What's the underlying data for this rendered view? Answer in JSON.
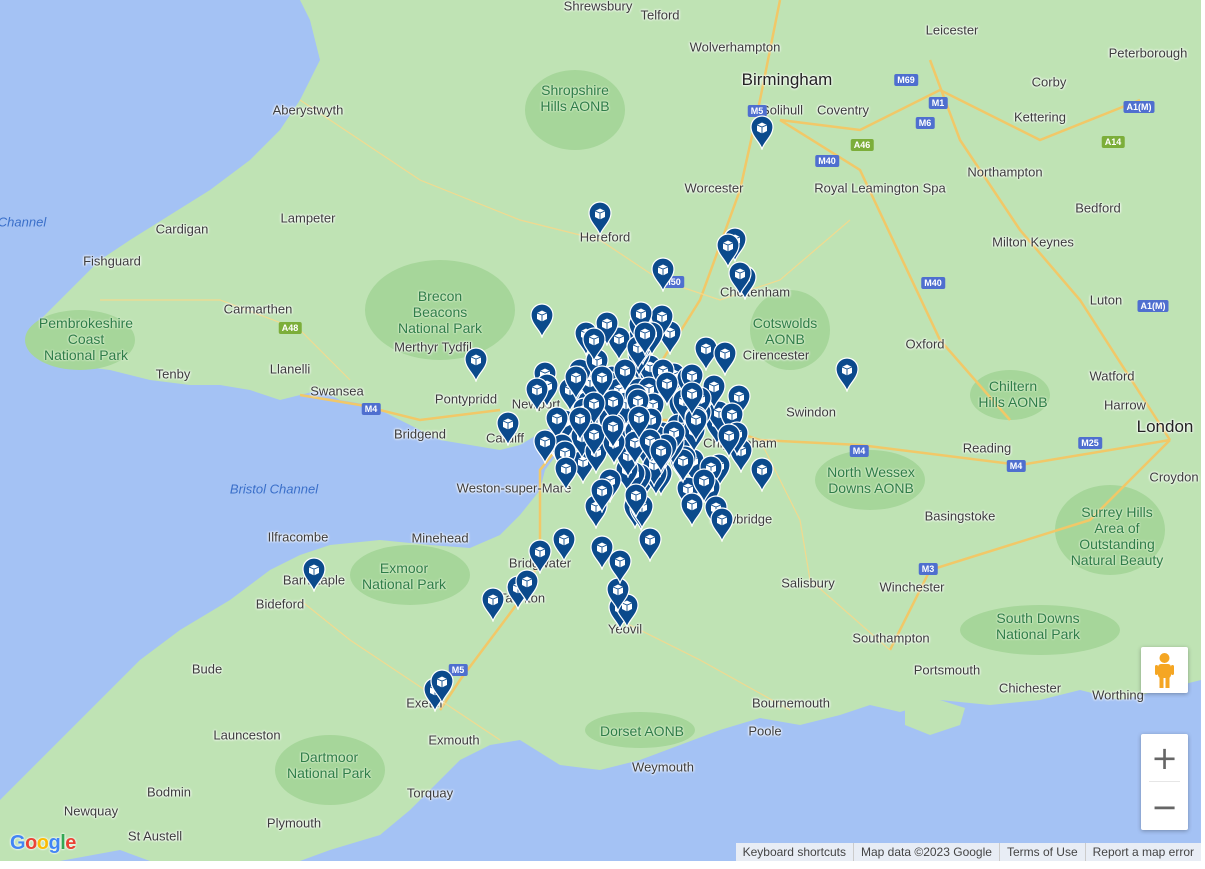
{
  "map": {
    "labels": [
      {
        "text": "Shrewsbury",
        "cls": ""
      },
      {
        "text": "Telford",
        "cls": ""
      },
      {
        "text": "Leicester",
        "cls": ""
      },
      {
        "text": "Wolverhampton",
        "cls": ""
      },
      {
        "text": "Peterborough",
        "cls": ""
      },
      {
        "text": "Birmingham",
        "cls": "major"
      },
      {
        "text": "Corby",
        "cls": ""
      },
      {
        "text": "Aberystwyth",
        "cls": ""
      },
      {
        "text": "Solihull",
        "cls": ""
      },
      {
        "text": "Coventry",
        "cls": ""
      },
      {
        "text": "Kettering",
        "cls": ""
      },
      {
        "text": "Royal Leamington Spa",
        "cls": ""
      },
      {
        "text": "Northampton",
        "cls": ""
      },
      {
        "text": "Worcester",
        "cls": ""
      },
      {
        "text": "Channel",
        "cls": "water"
      },
      {
        "text": "Cardigan",
        "cls": ""
      },
      {
        "text": "Lampeter",
        "cls": ""
      },
      {
        "text": "Hereford",
        "cls": ""
      },
      {
        "text": "Bedford",
        "cls": ""
      },
      {
        "text": "Milton Keynes",
        "cls": ""
      },
      {
        "text": "Fishguard",
        "cls": ""
      },
      {
        "text": "Carmarthen",
        "cls": ""
      },
      {
        "text": "Luton",
        "cls": ""
      },
      {
        "text": "Cheltenham",
        "cls": ""
      },
      {
        "text": "Merthyr Tydfil",
        "cls": ""
      },
      {
        "text": "Cirencester",
        "cls": ""
      },
      {
        "text": "Oxford",
        "cls": ""
      },
      {
        "text": "Llanelli",
        "cls": ""
      },
      {
        "text": "Tenby",
        "cls": ""
      },
      {
        "text": "Swansea",
        "cls": ""
      },
      {
        "text": "Watford",
        "cls": ""
      },
      {
        "text": "Pontypridd",
        "cls": ""
      },
      {
        "text": "Newport",
        "cls": ""
      },
      {
        "text": "Swindon",
        "cls": ""
      },
      {
        "text": "Harrow",
        "cls": ""
      },
      {
        "text": "Bridgend",
        "cls": ""
      },
      {
        "text": "Cardiff",
        "cls": ""
      },
      {
        "text": "Chippenham",
        "cls": ""
      },
      {
        "text": "Reading",
        "cls": ""
      },
      {
        "text": "London",
        "cls": "london"
      },
      {
        "text": "Croydon",
        "cls": ""
      },
      {
        "text": "Bristol Channel",
        "cls": "water"
      },
      {
        "text": "Weston-super-Mare",
        "cls": ""
      },
      {
        "text": "Trowbridge",
        "cls": ""
      },
      {
        "text": "Basingstoke",
        "cls": ""
      },
      {
        "text": "Ilfracombe",
        "cls": ""
      },
      {
        "text": "Minehead",
        "cls": ""
      },
      {
        "text": "Bridgwater",
        "cls": ""
      },
      {
        "text": "Barnstaple",
        "cls": ""
      },
      {
        "text": "Bideford",
        "cls": ""
      },
      {
        "text": "Taunton",
        "cls": ""
      },
      {
        "text": "Salisbury",
        "cls": ""
      },
      {
        "text": "Winchester",
        "cls": ""
      },
      {
        "text": "Yeovil",
        "cls": ""
      },
      {
        "text": "Southampton",
        "cls": ""
      },
      {
        "text": "Bude",
        "cls": ""
      },
      {
        "text": "Portsmouth",
        "cls": ""
      },
      {
        "text": "Chichester",
        "cls": ""
      },
      {
        "text": "Worthing",
        "cls": ""
      },
      {
        "text": "Exeter",
        "cls": ""
      },
      {
        "text": "Bournemouth",
        "cls": ""
      },
      {
        "text": "Launceston",
        "cls": ""
      },
      {
        "text": "Exmouth",
        "cls": ""
      },
      {
        "text": "Poole",
        "cls": ""
      },
      {
        "text": "Weymouth",
        "cls": ""
      },
      {
        "text": "Bodmin",
        "cls": ""
      },
      {
        "text": "Torquay",
        "cls": ""
      },
      {
        "text": "Newquay",
        "cls": ""
      },
      {
        "text": "Plymouth",
        "cls": ""
      },
      {
        "text": "St Austell",
        "cls": ""
      }
    ],
    "parks": [
      {
        "lines": [
          "Shropshire",
          "Hills AONB"
        ]
      },
      {
        "lines": [
          "Brecon",
          "Beacons",
          "National Park"
        ]
      },
      {
        "lines": [
          "Pembrokeshire",
          "Coast",
          "National Park"
        ]
      },
      {
        "lines": [
          "Cotswolds",
          "AONB"
        ]
      },
      {
        "lines": [
          "Chiltern",
          "Hills AONB"
        ]
      },
      {
        "lines": [
          "North Wessex",
          "Downs AONB"
        ]
      },
      {
        "lines": [
          "Surrey Hills",
          "Area of",
          "Outstanding",
          "Natural Beauty"
        ]
      },
      {
        "lines": [
          "Exmoor",
          "National Park"
        ]
      },
      {
        "lines": [
          "South Downs",
          "National Park"
        ]
      },
      {
        "lines": [
          "Dorset AONB"
        ]
      },
      {
        "lines": [
          "Dartmoor",
          "National Park"
        ]
      }
    ],
    "shields": [
      "M5",
      "M69",
      "M1",
      "M6",
      "M40",
      "A46",
      "A1(M)",
      "A14",
      "M40",
      "A1(M)",
      "A48",
      "M4",
      "M4",
      "M4",
      "M25",
      "M3",
      "M5",
      "M50"
    ],
    "marker_color": "#0b4a8c",
    "marker_count": 170
  },
  "controls": {
    "zoom_in": "+",
    "zoom_out": "−",
    "pegman": "pegman-icon"
  },
  "footer": {
    "keyboard": "Keyboard shortcuts",
    "mapdata": "Map data ©2023 Google",
    "terms": "Terms of Use",
    "report": "Report a map error"
  },
  "logo": {
    "text": "Google"
  }
}
